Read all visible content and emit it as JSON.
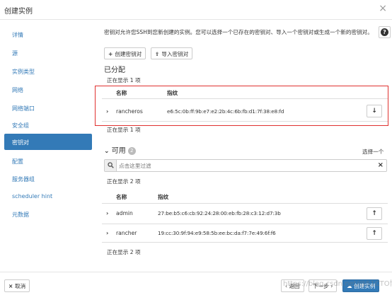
{
  "dialog": {
    "title": "创建实例",
    "close_glyph": "×"
  },
  "sidebar": {
    "items": [
      {
        "label": "详情"
      },
      {
        "label": "源"
      },
      {
        "label": "实例类型"
      },
      {
        "label": "网络"
      },
      {
        "label": "网络端口"
      },
      {
        "label": "安全组"
      },
      {
        "label": "密钥对"
      },
      {
        "label": "配置"
      },
      {
        "label": "服务器组"
      },
      {
        "label": "scheduler hint"
      },
      {
        "label": "元数据"
      }
    ],
    "active_index": 6
  },
  "main": {
    "help_text": "密钥对允许您SSH到您新创建的实例。您可以选择一个已存在的密钥对、导入一个密钥对或生成一个新的密钥对。",
    "create_keypair_label": "创建密钥对",
    "import_keypair_label": "导入密钥对",
    "allocated": {
      "title": "已分配",
      "showing_top": "正在显示 1 项",
      "showing_bottom": "正在显示 1 项",
      "col_name": "名称",
      "col_fingerprint": "指纹",
      "rows": [
        {
          "name": "rancheros",
          "fingerprint": "e6:5c:0b:ff:9b:e7:e2:2b:4c:6b:fb:d1:7f:38:e8:fd"
        }
      ]
    },
    "available": {
      "title": "可用",
      "count": "2",
      "select_one": "选择一个",
      "search_placeholder": "点击这里过滤",
      "showing_top": "正在显示 2 项",
      "showing_bottom": "正在显示 2 项",
      "col_name": "名称",
      "col_fingerprint": "指纹",
      "rows": [
        {
          "name": "admin",
          "fingerprint": "27:be:b5:c6:cb:92:24:28:00:eb:fb:28:c3:12:d7:3b"
        },
        {
          "name": "rancher",
          "fingerprint": "19:cc:30:9f:94:e9:58:5b:ee:bc:da:f7:7e:49:6f:f6"
        }
      ]
    }
  },
  "footer": {
    "cancel_label": "取消",
    "back_label": "返回",
    "next_label": "下一步",
    "create_label": "创建实例"
  },
  "watermark": "https://blog.csdn.net/@51CTO博客",
  "colors": {
    "accent": "#337ab7",
    "highlight_box": "#e0312f"
  }
}
